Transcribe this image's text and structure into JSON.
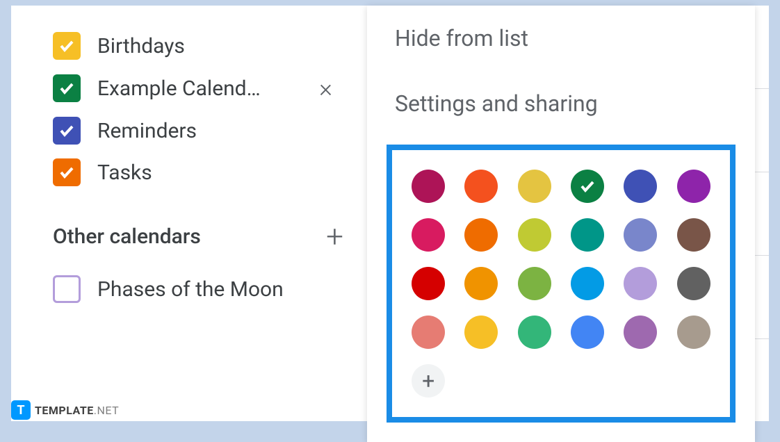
{
  "sidebar": {
    "calendars": [
      {
        "label": "Birthdays",
        "color": "#f6bf26",
        "checked": true,
        "hovered": false
      },
      {
        "label": "Example Calend…",
        "color": "#0b8043",
        "checked": true,
        "hovered": true
      },
      {
        "label": "Reminders",
        "color": "#3f51b5",
        "checked": true,
        "hovered": false
      },
      {
        "label": "Tasks",
        "color": "#ef6c00",
        "checked": true,
        "hovered": false
      }
    ],
    "section_title": "Other calendars",
    "other_calendars": [
      {
        "label": "Phases of the Moon",
        "color": "#b39ddb",
        "checked": false
      }
    ]
  },
  "popup": {
    "menu_items": [
      "Hide from list",
      "Settings and sharing"
    ],
    "colors": [
      "#ad1457",
      "#f4511e",
      "#e4c441",
      "#0b8043",
      "#3f51b5",
      "#8e24aa",
      "#d81b60",
      "#ef6c00",
      "#c0ca33",
      "#009688",
      "#7986cb",
      "#795548",
      "#d50000",
      "#f09300",
      "#7cb342",
      "#039be5",
      "#b39ddb",
      "#616161",
      "#e67c73",
      "#f6bf26",
      "#33b679",
      "#4285f4",
      "#9e69af",
      "#a79b8e"
    ],
    "selected_color_index": 3
  },
  "watermark": {
    "icon_letter": "T",
    "text_main": "TEMPLATE",
    "text_suffix": ".NET"
  }
}
